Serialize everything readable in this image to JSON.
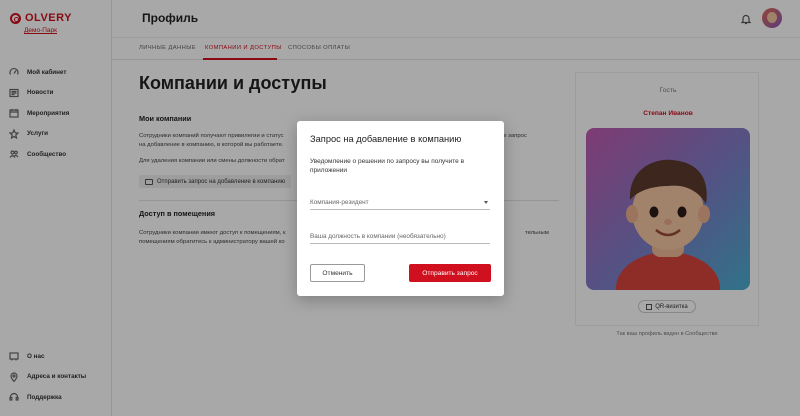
{
  "brand": {
    "name": "OLVERY",
    "park_link": "Демо-Парк",
    "accent": "#d0101e"
  },
  "sidebar": {
    "items": [
      {
        "label": "Мой кабинет",
        "icon": "gauge-icon"
      },
      {
        "label": "Новости",
        "icon": "newspaper-icon"
      },
      {
        "label": "Мероприятия",
        "icon": "calendar-icon"
      },
      {
        "label": "Услуги",
        "icon": "star-icon"
      },
      {
        "label": "Сообщество",
        "icon": "people-icon"
      }
    ],
    "bottom_items": [
      {
        "label": "О нас",
        "icon": "info-board-icon"
      },
      {
        "label": "Адреса и контакты",
        "icon": "location-pin-icon"
      },
      {
        "label": "Поддержка",
        "icon": "headset-icon"
      }
    ]
  },
  "header": {
    "title": "Профиль"
  },
  "tabs": [
    {
      "label": "Личные данные"
    },
    {
      "label": "Компании и доступы",
      "active": true
    },
    {
      "label": "Способы оплаты"
    }
  ],
  "main": {
    "title": "Компании и доступы",
    "companies": {
      "title": "Мои компании",
      "text_line1": "Сотрудники компаний получают привилегии и статус",
      "text_line1_end": "ьте запрос",
      "text_line2": "на добавление в компанию, в которой вы работаете.",
      "text_line3": "Для удаления компании или смены должности обрат",
      "request_button": "Отправить запрос на добавление в компанию"
    },
    "access": {
      "title": "Доступ в помещения",
      "text_line1": "Сотрудники компании имеют доступ к помещениям, к",
      "text_line1_end": "тельным",
      "text_line2": "помещениям обратитесь к администратору вашей ко"
    }
  },
  "profile": {
    "role": "Гость",
    "name": "Степан Иванов",
    "qr_button": "QR-визитка",
    "note": "Так ваш профиль виден в Сообществе"
  },
  "modal": {
    "title": "Запрос на добавление в компанию",
    "subtitle": "Уведомление о решении по запросу вы получите в приложении",
    "company_placeholder": "Компания-резидент",
    "position_placeholder": "Ваша должность в компании (необязательно)",
    "cancel_label": "Отменить",
    "submit_label": "Отправить запрос"
  }
}
